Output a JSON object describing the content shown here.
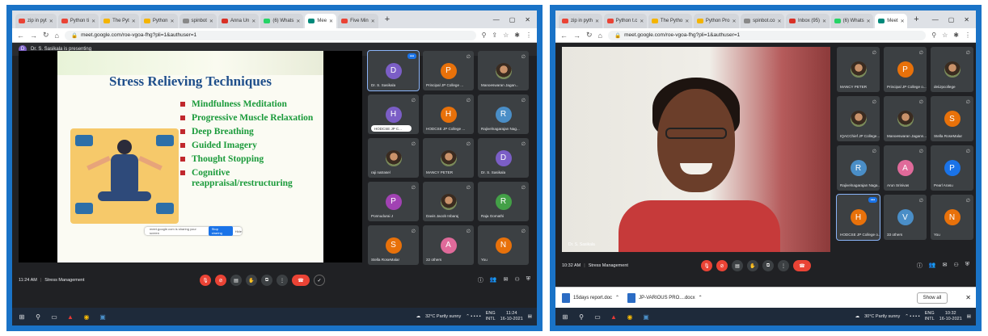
{
  "left": {
    "tabs": [
      {
        "label": "zip in pyt",
        "color": "#ea4335"
      },
      {
        "label": "Python ti",
        "color": "#ea4335"
      },
      {
        "label": "The Pyt",
        "color": "#f4b400"
      },
      {
        "label": "Python",
        "color": "#f4b400"
      },
      {
        "label": "spinbot",
        "color": "#888888"
      },
      {
        "label": "Anna Un",
        "color": "#d93025"
      },
      {
        "label": "(6) Whats",
        "color": "#25d366"
      },
      {
        "label": "Mee",
        "color": "#00897b",
        "active": true
      },
      {
        "label": "Five Min",
        "color": "#ea4335"
      }
    ],
    "url": "meet.google.com/roe-vgoa-fhg?pli=1&authuser=1",
    "presenting_initial": "D",
    "presenting_text": "Dr. S. Sasikala is presenting",
    "slide": {
      "title": "Stress Relieving Techniques",
      "bullets": [
        "Mindfulness Meditation",
        "Progressive Muscle Relaxation",
        "Deep Breathing",
        "Guided Imagery",
        "Thought Stopping",
        "Cognitive reappraisal/restructuring"
      ],
      "share_text": "meet.google.com is sharing your screen",
      "share_stop": "Stop sharing",
      "share_hide": "Hide"
    },
    "tiles": [
      {
        "initial": "D",
        "name": "Dr. S. Sasikala",
        "color": "#7b5ec6",
        "more": true,
        "highlight": true
      },
      {
        "initial": "P",
        "name": "Principal JP College ...",
        "color": "#e8710a"
      },
      {
        "photo": true,
        "name": "Manoeswaran Jagan..."
      },
      {
        "initial": "H",
        "name": "HODCSE JP C...",
        "color": "#7b5ec6",
        "pill": true
      },
      {
        "initial": "H",
        "name": "HODCSE JP College ...",
        "color": "#e8710a"
      },
      {
        "initial": "R",
        "name": "Rajivelnagarajan Nag...",
        "color": "#4a8ec7"
      },
      {
        "photo": true,
        "name": "raji natrasel"
      },
      {
        "photo": true,
        "name": "MANCY PETER"
      },
      {
        "initial": "D",
        "name": "Dr. S. Sasikala",
        "color": "#7b5ec6"
      },
      {
        "initial": "P",
        "name": "Ponnudurai J",
        "color": "#a142b3"
      },
      {
        "photo": true,
        "name": "Davis Jacob Inbaraj"
      },
      {
        "initial": "R",
        "name": "Raja Gomathi",
        "color": "#43a047"
      },
      {
        "initial": "S",
        "name": "Stella RoseMalar",
        "color": "#e8710a"
      },
      {
        "initial": "A",
        "name": "22 others",
        "color": "#e06a9a"
      },
      {
        "initial": "N",
        "name": "You",
        "color": "#e8710a"
      }
    ],
    "time": "11:24 AM",
    "meeting": "Stress Management",
    "weather": "32°C  Partly sunny",
    "lang": "ENG",
    "lang2": "INTL",
    "clock_time": "11:24",
    "clock_date": "16-10-2021"
  },
  "right": {
    "tabs": [
      {
        "label": "zip in pyth",
        "color": "#ea4335"
      },
      {
        "label": "Python t.c",
        "color": "#ea4335"
      },
      {
        "label": "The Pytho",
        "color": "#f4b400"
      },
      {
        "label": "Python Pro",
        "color": "#f4b400"
      },
      {
        "label": "spinbot.co",
        "color": "#888888"
      },
      {
        "label": "Inbox (95)",
        "color": "#d93025"
      },
      {
        "label": "(6) Whats",
        "color": "#25d366"
      },
      {
        "label": "Meet",
        "color": "#00897b",
        "active": true
      }
    ],
    "url": "meet.google.com/roe-vgoa-fhg?pli=1&authuser=1",
    "video_name": "Dr. S. Sasikala",
    "tiles": [
      {
        "photo": true,
        "name": "MANCY PETER"
      },
      {
        "initial": "P",
        "name": "Principal JP College o...",
        "color": "#e8710a"
      },
      {
        "photo": true,
        "name": "deiiJpcollege"
      },
      {
        "photo": true,
        "name": "IQACChief JP College..."
      },
      {
        "photo": true,
        "name": "Manoeswaran Jagann..."
      },
      {
        "initial": "S",
        "name": "Stella RoseMalar",
        "color": "#e8710a"
      },
      {
        "initial": "R",
        "name": "Rajivelnagarajan Naga...",
        "color": "#4a8ec7"
      },
      {
        "initial": "A",
        "name": "Arun Srinivas",
        "color": "#e06a9a"
      },
      {
        "initial": "P",
        "name": "Pearl Arasu",
        "color": "#1a73e8"
      },
      {
        "initial": "H",
        "name": "HODCSE JP College o...",
        "color": "#e8710a",
        "more": true,
        "highlight": true
      },
      {
        "initial": "V",
        "name": "33 others",
        "color": "#4a8ec7"
      },
      {
        "initial": "N",
        "name": "You",
        "color": "#e8710a"
      }
    ],
    "time": "10:32 AM",
    "meeting": "Stress Management",
    "downloads": [
      "15days report.doc",
      "JP-VARIOUS PRO....docx"
    ],
    "show_all": "Show all",
    "weather": "30°C  Partly sunny",
    "lang": "ENG",
    "lang2": "INTL",
    "clock_time": "10:32",
    "clock_date": "16-10-2021"
  }
}
